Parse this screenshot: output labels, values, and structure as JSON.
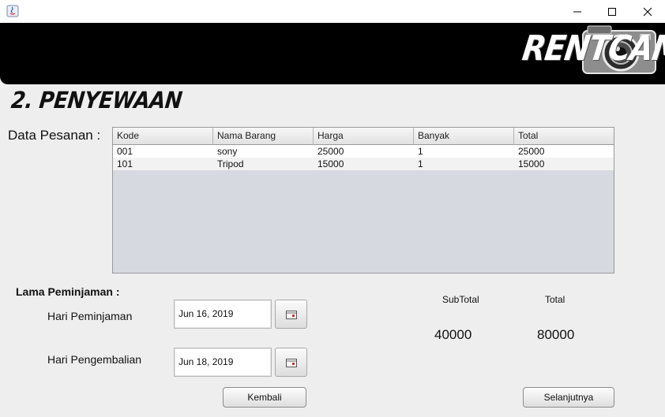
{
  "window": {
    "icon": "java-icon",
    "controls": [
      "minimize-icon",
      "maximize-icon",
      "close-icon"
    ]
  },
  "banner": {
    "logo_text": "RENTCAM",
    "logo_icon": "camera-icon",
    "background": "#000000"
  },
  "page": {
    "title": "2. PENYEWAAN",
    "data_pesanan_label": "Data Pesanan :"
  },
  "table": {
    "columns": [
      "Kode",
      "Nama Barang",
      "Harga",
      "Banyak",
      "Total"
    ],
    "rows": [
      [
        "001",
        "sony",
        "25000",
        "1",
        "25000"
      ],
      [
        "101",
        "Tripod",
        "15000",
        "1",
        "15000"
      ]
    ]
  },
  "form": {
    "lama_label": "Lama Peminjaman :",
    "hari_peminjaman_label": "Hari Peminjaman",
    "hari_peminjaman_value": "Jun 16, 2019",
    "hari_pengembalian_label": "Hari Pengembalian",
    "hari_pengembalian_value": "Jun 18, 2019",
    "calendar_icon": "calendar-icon"
  },
  "summary": {
    "subtotal_label": "SubTotal",
    "subtotal_value": "40000",
    "total_label": "Total",
    "total_value": "80000"
  },
  "buttons": {
    "kembali": "Kembali",
    "selanjutnya": "Selanjutnya"
  }
}
